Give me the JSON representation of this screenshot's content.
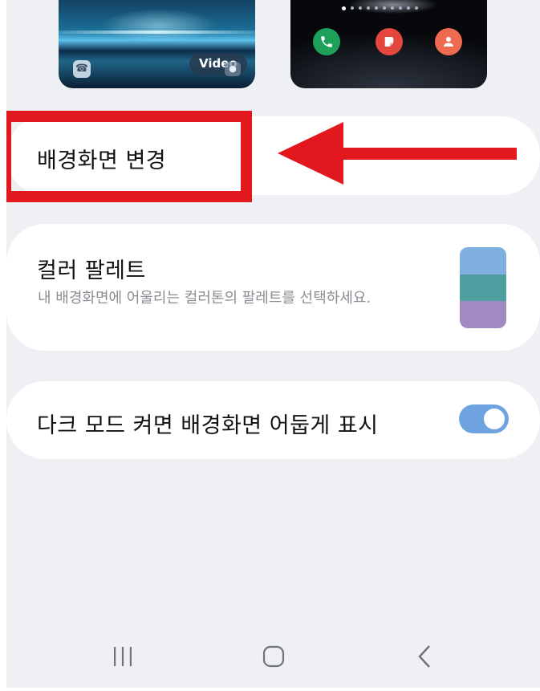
{
  "previews": {
    "lock_screen": {
      "video_label": "Video"
    },
    "home_screen": {
      "page_indicator_count": 10,
      "active_page": 1,
      "apps": [
        "phone-icon",
        "samsung-notes-icon",
        "contacts-icon"
      ]
    }
  },
  "settings": {
    "change_wallpaper": {
      "label": "배경화면 변경"
    },
    "color_palette": {
      "label": "컬러 팔레트",
      "description": "내 배경화면에 어울리는 컬러톤의 팔레트를 선택하세요.",
      "swatch_colors": [
        "#7fb0e0",
        "#4f9ea0",
        "#a18ac4"
      ]
    },
    "dark_mode_dim": {
      "label": "다크 모드 켜면 배경화면 어둡게 표시",
      "enabled": true,
      "toggle_color": "#6fa3e0"
    }
  },
  "annotation": {
    "color": "#e3181f"
  },
  "navbar": {
    "buttons": [
      "recents-icon",
      "home-icon",
      "back-icon"
    ]
  }
}
